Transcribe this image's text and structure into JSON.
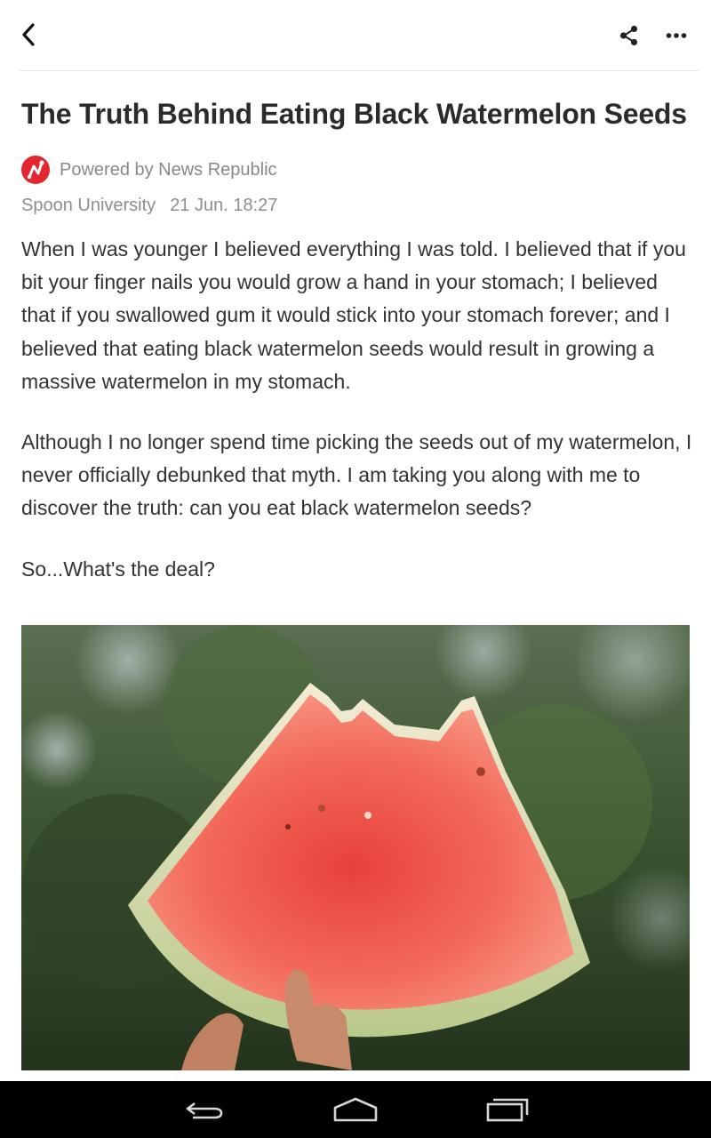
{
  "article": {
    "title": "The Truth Behind Eating Black Watermelon Seeds",
    "powered_by": "Powered by News Republic",
    "source": "Spoon University",
    "date": "21 Jun. 18:27",
    "paragraphs": [
      "When I was younger I believed everything I was told. I believed that if you bit your finger nails you would grow a hand in your stomach; I believed that if you swallowed gum it would stick into your stomach forever; and I believed that eating black watermelon seeds would result in growing a massive watermelon in my stomach.",
      "Although I no longer spend time picking the seeds out of my watermelon, I never officially debunked that myth. I am taking you along with me to discover the truth: can you eat black watermelon seeds?",
      "So...What's the deal?"
    ]
  },
  "icons": {
    "back": "chevron-left-icon",
    "share": "share-icon",
    "more": "more-horizontal-icon",
    "logo": "news-republic-logo",
    "nav_back": "nav-back-icon",
    "nav_home": "nav-home-icon",
    "nav_recent": "nav-recent-apps-icon"
  },
  "colors": {
    "brand_red": "#e3262f",
    "text": "#333333",
    "muted": "#8e8e8e",
    "navbar": "#000000"
  }
}
